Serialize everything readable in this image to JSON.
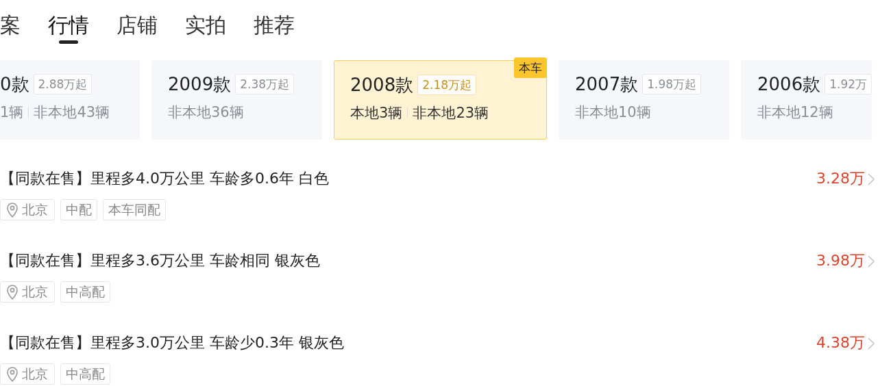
{
  "tabs": [
    {
      "label": "案",
      "selected": false
    },
    {
      "label": "行情",
      "selected": true
    },
    {
      "label": "店铺",
      "selected": false
    },
    {
      "label": "实拍",
      "selected": false
    },
    {
      "label": "推荐",
      "selected": false
    }
  ],
  "model_cards": [
    {
      "year": "0款",
      "price": "2.88万起",
      "local": "1辆",
      "nonlocal": "非本地43辆",
      "selected": false
    },
    {
      "year": "2009款",
      "price": "2.38万起",
      "nonlocal": "非本地36辆",
      "selected": false
    },
    {
      "year": "2008款",
      "price": "2.18万起",
      "local": "本地3辆",
      "nonlocal": "非本地23辆",
      "selected": true,
      "badge": "本车"
    },
    {
      "year": "2007款",
      "price": "1.98万起",
      "nonlocal": "非本地10辆",
      "selected": false
    },
    {
      "year": "2006款",
      "price": "1.92万",
      "nonlocal": "非本地12辆",
      "selected": false
    }
  ],
  "listings": [
    {
      "title": "【同款在售】里程多4.0万公里 车龄多0.6年 白色",
      "price": "3.28万",
      "location": "北京",
      "tags": [
        "中配",
        "本车同配"
      ]
    },
    {
      "title": "【同款在售】里程多3.6万公里 车龄相同 银灰色",
      "price": "3.98万",
      "location": "北京",
      "tags": [
        "中高配"
      ]
    },
    {
      "title": "【同款在售】里程多3.0万公里 车龄少0.3年 银灰色",
      "price": "4.38万",
      "location": "北京",
      "tags": [
        "中高配"
      ]
    }
  ]
}
